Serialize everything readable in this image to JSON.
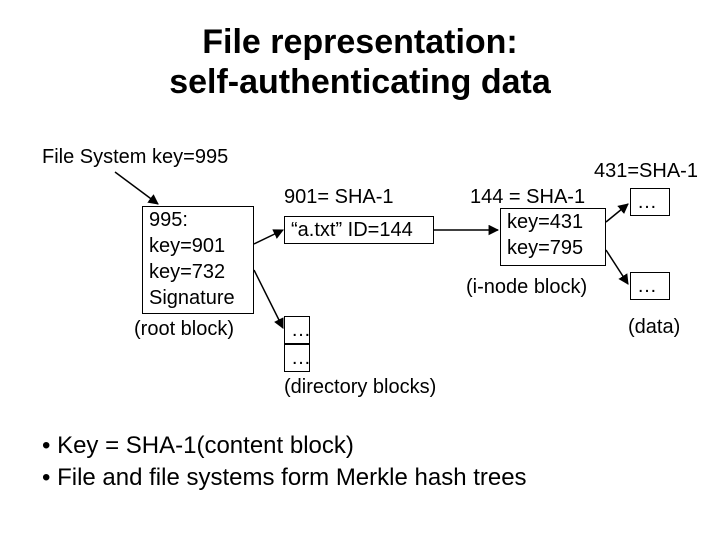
{
  "title_line1": "File representation:",
  "title_line2": "self-authenticating data",
  "fs_key": "File System key=995",
  "root_box": {
    "l1": "995:",
    "l2": "key=901",
    "l3": "key=732",
    "l4": "Signature"
  },
  "root_label": "(root block)",
  "dir_header": "901= SHA-1",
  "dir_entry": "“a.txt” ID=144",
  "ellipsis": "…",
  "dirblocks_label": "(directory blocks)",
  "inode_header": "144 = SHA-1",
  "inode_box": {
    "l1": "key=431",
    "l2": "key=795"
  },
  "inode_label": "(i-node block)",
  "data_header": "431=SHA-1",
  "data_label": "(data)",
  "bullet1": "• Key = SHA-1(content block)",
  "bullet2": "• File and file systems form Merkle hash trees"
}
